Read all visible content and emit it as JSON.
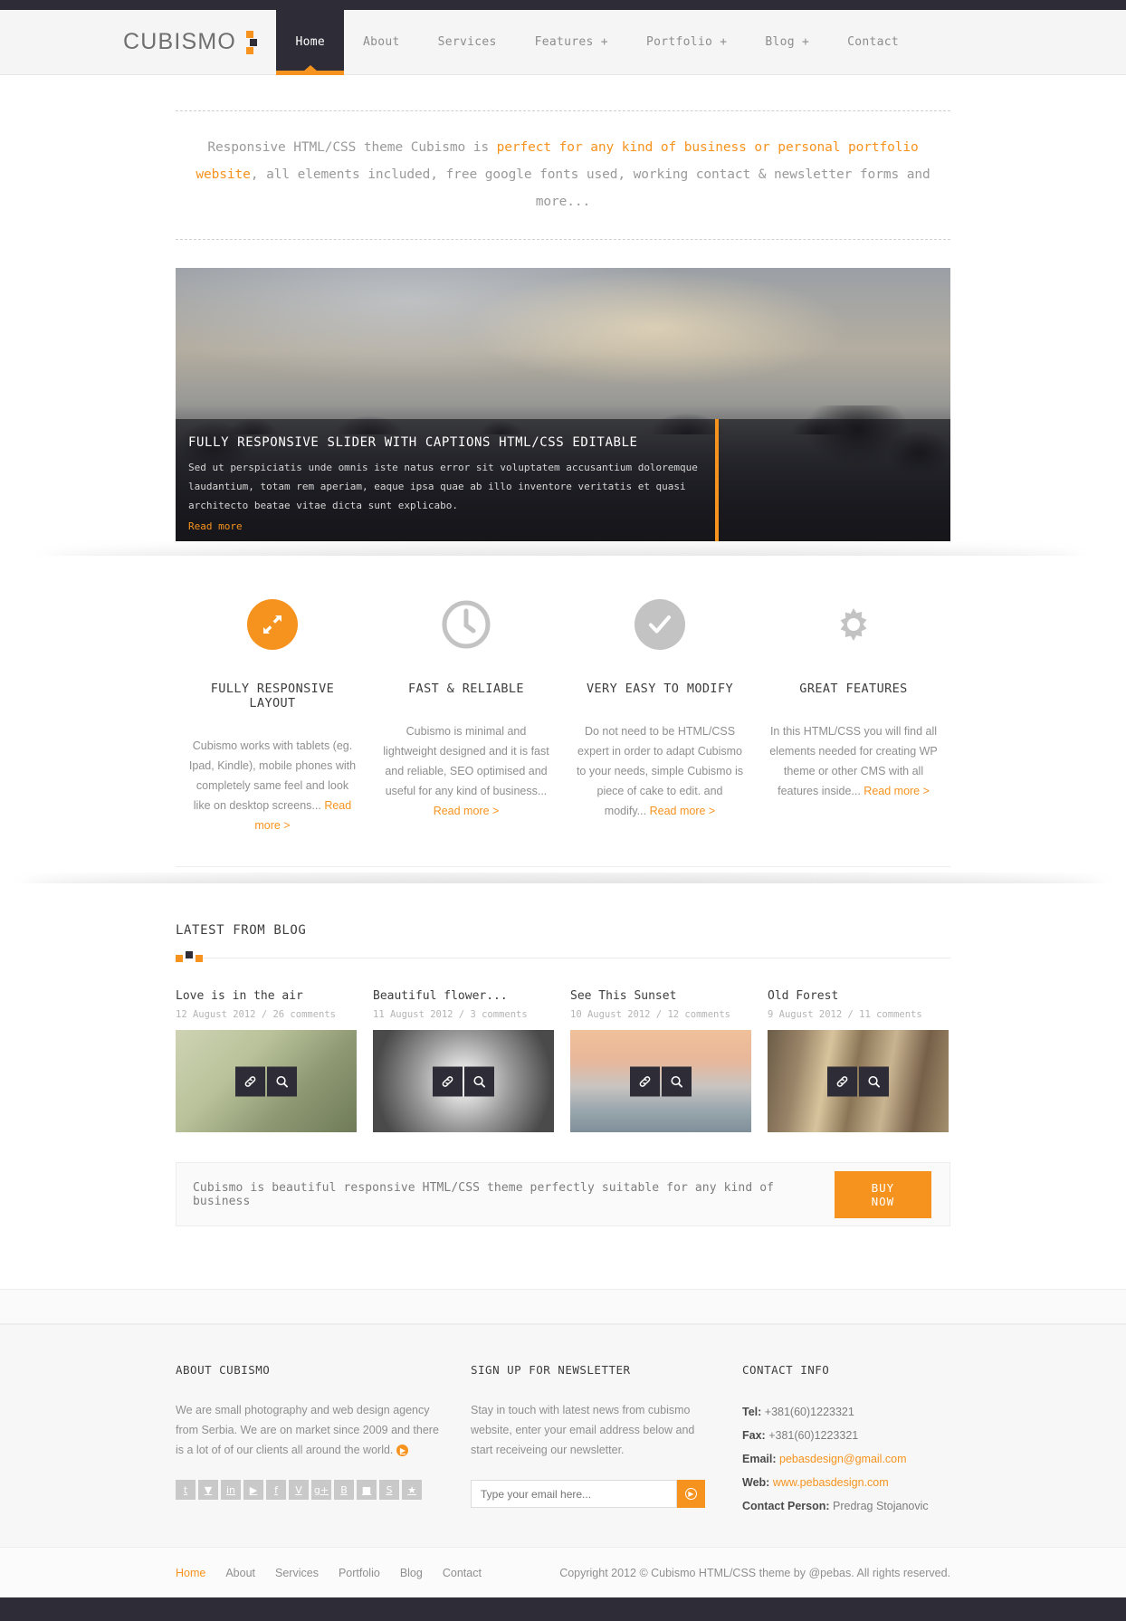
{
  "brand": {
    "name": "CUBISMO"
  },
  "nav": {
    "items": [
      {
        "label": "Home",
        "active": true
      },
      {
        "label": "About",
        "active": false
      },
      {
        "label": "Services",
        "active": false
      },
      {
        "label": "Features +",
        "active": false
      },
      {
        "label": "Portfolio +",
        "active": false
      },
      {
        "label": "Blog +",
        "active": false
      },
      {
        "label": "Contact",
        "active": false
      }
    ]
  },
  "tagline": {
    "pre": "Responsive HTML/CSS theme Cubismo is ",
    "highlight": "perfect for any kind of business or personal portfolio website",
    "post": ", all elements included, free google fonts used, working contact & newsletter forms and more..."
  },
  "slider": {
    "title": "FULLY RESPONSIVE SLIDER WITH CAPTIONS HTML/CSS EDITABLE",
    "body": "Sed ut perspiciatis unde omnis iste natus error sit voluptatem accusantium doloremque laudantium, totam rem aperiam, eaque ipsa quae ab illo inventore veritatis et quasi architecto beatae vitae dicta sunt explicabo.",
    "link": "Read more"
  },
  "features": [
    {
      "icon": "expand-arrows-icon",
      "style": "orange",
      "title": "FULLY RESPONSIVE LAYOUT",
      "body": "Cubismo works with tablets (eg. Ipad, Kindle), mobile phones with completely same feel and look like on desktop screens...",
      "link": "Read more >"
    },
    {
      "icon": "clock-icon",
      "style": "plain",
      "title": "FAST & RELIABLE",
      "body": "Cubismo is minimal and lightweight designed and it is fast and reliable, SEO optimised and useful for any kind of business...",
      "link": "Read more >"
    },
    {
      "icon": "check-circle-icon",
      "style": "grey",
      "title": "VERY EASY TO MODIFY",
      "body": "Do not need to be HTML/CSS expert in order to adapt Cubismo to your needs, simple Cubismo is piece of cake to edit. and modify...",
      "link": "Read more >"
    },
    {
      "icon": "gear-icon",
      "style": "plain",
      "title": "GREAT FEATURES",
      "body": "In this HTML/CSS you will find all elements needed for creating WP theme or other CMS with all features inside...",
      "link": "Read more >"
    }
  ],
  "blog": {
    "title": "LATEST FROM BLOG",
    "posts": [
      {
        "title": "Love is in the air",
        "meta": "12 August 2012 / 26 comments",
        "thumb_class": "th1"
      },
      {
        "title": "Beautiful flower...",
        "meta": "11 August 2012 / 3 comments",
        "thumb_class": "th2"
      },
      {
        "title": "See This Sunset",
        "meta": "10 August 2012 / 12 comments",
        "thumb_class": "th3"
      },
      {
        "title": "Old Forest",
        "meta": "9 August 2012 / 11 comments",
        "thumb_class": "th4"
      }
    ],
    "overlay_icons": [
      "link-icon",
      "search-icon"
    ]
  },
  "cta": {
    "text": "Cubismo is beautiful responsive HTML/CSS theme perfectly suitable for any kind of business",
    "button": "BUY NOW"
  },
  "footer": {
    "about": {
      "title": "ABOUT CUBISMO",
      "body": "We are small photography and web design agency from Serbia. We are on market since 2009 and there is a lot of of our clients all around the world.",
      "socials": [
        "t",
        "▼",
        "in",
        "▶",
        "f",
        "V",
        "g+",
        "B",
        "■",
        "S",
        "★"
      ]
    },
    "newsletter": {
      "title": "SIGN UP FOR NEWSLETTER",
      "body": "Stay in touch with latest news from cubismo website, enter your email address below and start receiveing our newsletter.",
      "placeholder": "Type your email here...",
      "value": ""
    },
    "contact": {
      "title": "CONTACT INFO",
      "tel_label": "Tel:",
      "tel": "+381(60)1223321",
      "fax_label": "Fax:",
      "fax": "+381(60)1223321",
      "email_label": "Email:",
      "email": "pebasdesign@gmail.com",
      "web_label": "Web:",
      "web": "www.pebasdesign.com",
      "person_label": "Contact Person:",
      "person": "Predrag Stojanovic"
    }
  },
  "bottom": {
    "links": [
      {
        "label": "Home",
        "on": true
      },
      {
        "label": "About",
        "on": false
      },
      {
        "label": "Services",
        "on": false
      },
      {
        "label": "Portfolio",
        "on": false
      },
      {
        "label": "Blog",
        "on": false
      },
      {
        "label": "Contact",
        "on": false
      }
    ],
    "copyright": "Copyright 2012 © Cubismo HTML/CSS theme by @pebas. All rights reserved."
  },
  "colors": {
    "accent": "#f6931e",
    "dark": "#2e2c36"
  }
}
